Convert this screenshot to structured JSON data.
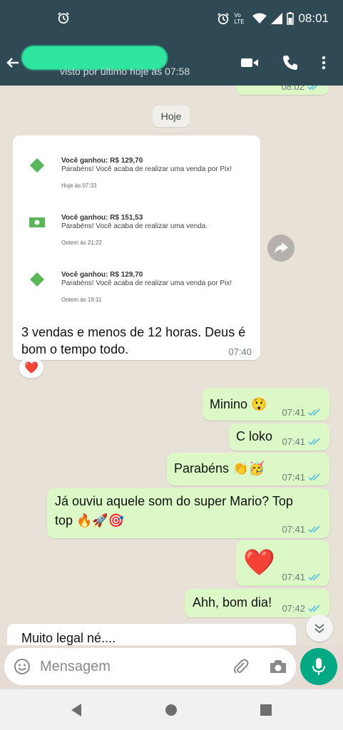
{
  "status_bar": {
    "time": "08:01",
    "carrier_label": "Vo LTE"
  },
  "header": {
    "last_seen": "visto por último hoje às 07:58"
  },
  "chat": {
    "prev_message_time": "08:02",
    "date_chip": "Hoje",
    "forwarded_message": {
      "notifications": [
        {
          "title": "Você ganhou: R$ 129,70",
          "body": "Parabéns! Você acaba de realizar uma venda por Pix!",
          "time": "Hoje às 07:33",
          "icon": "pix-icon"
        },
        {
          "title": "Você ganhou: R$ 151,53",
          "body": "Parabéns! Você acaba de realizar uma venda.",
          "time": "Ontem às 21:22",
          "icon": "cash-icon"
        },
        {
          "title": "Você ganhou: R$ 129,70",
          "body": "Parabéns! Você acaba de realizar uma venda por Pix!",
          "time": "Ontem às 19:11",
          "icon": "pix-icon"
        }
      ],
      "text_line1": "3 vendas e menos de 12 horas. Deus é",
      "text_line2": "bom o tempo todo.",
      "time": "07:40",
      "reaction": "❤️"
    },
    "messages": [
      {
        "text": "Minino 😲",
        "time": "07:41"
      },
      {
        "text": "C loko",
        "time": "07:41"
      },
      {
        "text": "Parabéns 👏🥳",
        "time": "07:41"
      },
      {
        "text_line1": "Já ouviu aquele som do super Mario? Top",
        "text_line2": "top 🔥🚀🎯",
        "time": "07:41"
      },
      {
        "text": "❤️",
        "time": "07:41"
      },
      {
        "text": "Ahh, bom dia!",
        "time": "07:42"
      }
    ],
    "incoming_partial": "Muito legal né...."
  },
  "input": {
    "placeholder": "Mensagem"
  },
  "colors": {
    "header": "#2f4a54",
    "outgoing_bubble": "#dcf8c6",
    "accent": "#00a884",
    "read_ticks": "#53bdeb"
  }
}
